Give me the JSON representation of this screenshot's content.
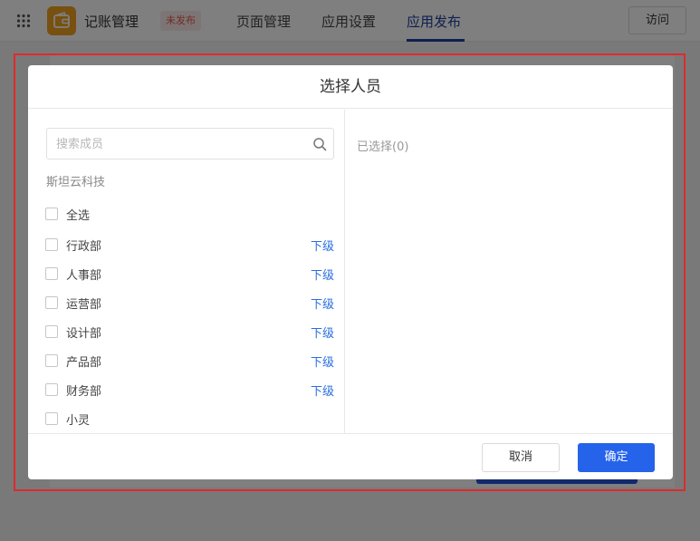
{
  "topbar": {
    "app_name": "记账管理",
    "status_badge": "未发布",
    "tabs": [
      {
        "label": "页面管理"
      },
      {
        "label": "应用设置"
      },
      {
        "label": "应用发布"
      }
    ],
    "active_tab": "应用发布",
    "visit_label": "访问"
  },
  "modal": {
    "title": "选择人员",
    "search": {
      "placeholder": "搜索成员",
      "value": ""
    },
    "company": "斯坦云科技",
    "select_all": "全选",
    "sub_label": "下级",
    "items": [
      {
        "label": "行政部"
      },
      {
        "label": "人事部"
      },
      {
        "label": "运营部"
      },
      {
        "label": "设计部"
      },
      {
        "label": "产品部"
      },
      {
        "label": "财务部"
      },
      {
        "label": "小灵"
      }
    ],
    "selected_label": "已选择(0)",
    "cancel_label": "取消",
    "confirm_label": "确定"
  },
  "colors": {
    "primary": "#2563eb",
    "link": "#2a6ee0",
    "highlight_frame": "#e02a2a",
    "app_logo": "#f0a020",
    "active_tab": "#1e3ea0"
  },
  "icons": [
    "grid-icon",
    "wallet-icon",
    "search-icon"
  ]
}
